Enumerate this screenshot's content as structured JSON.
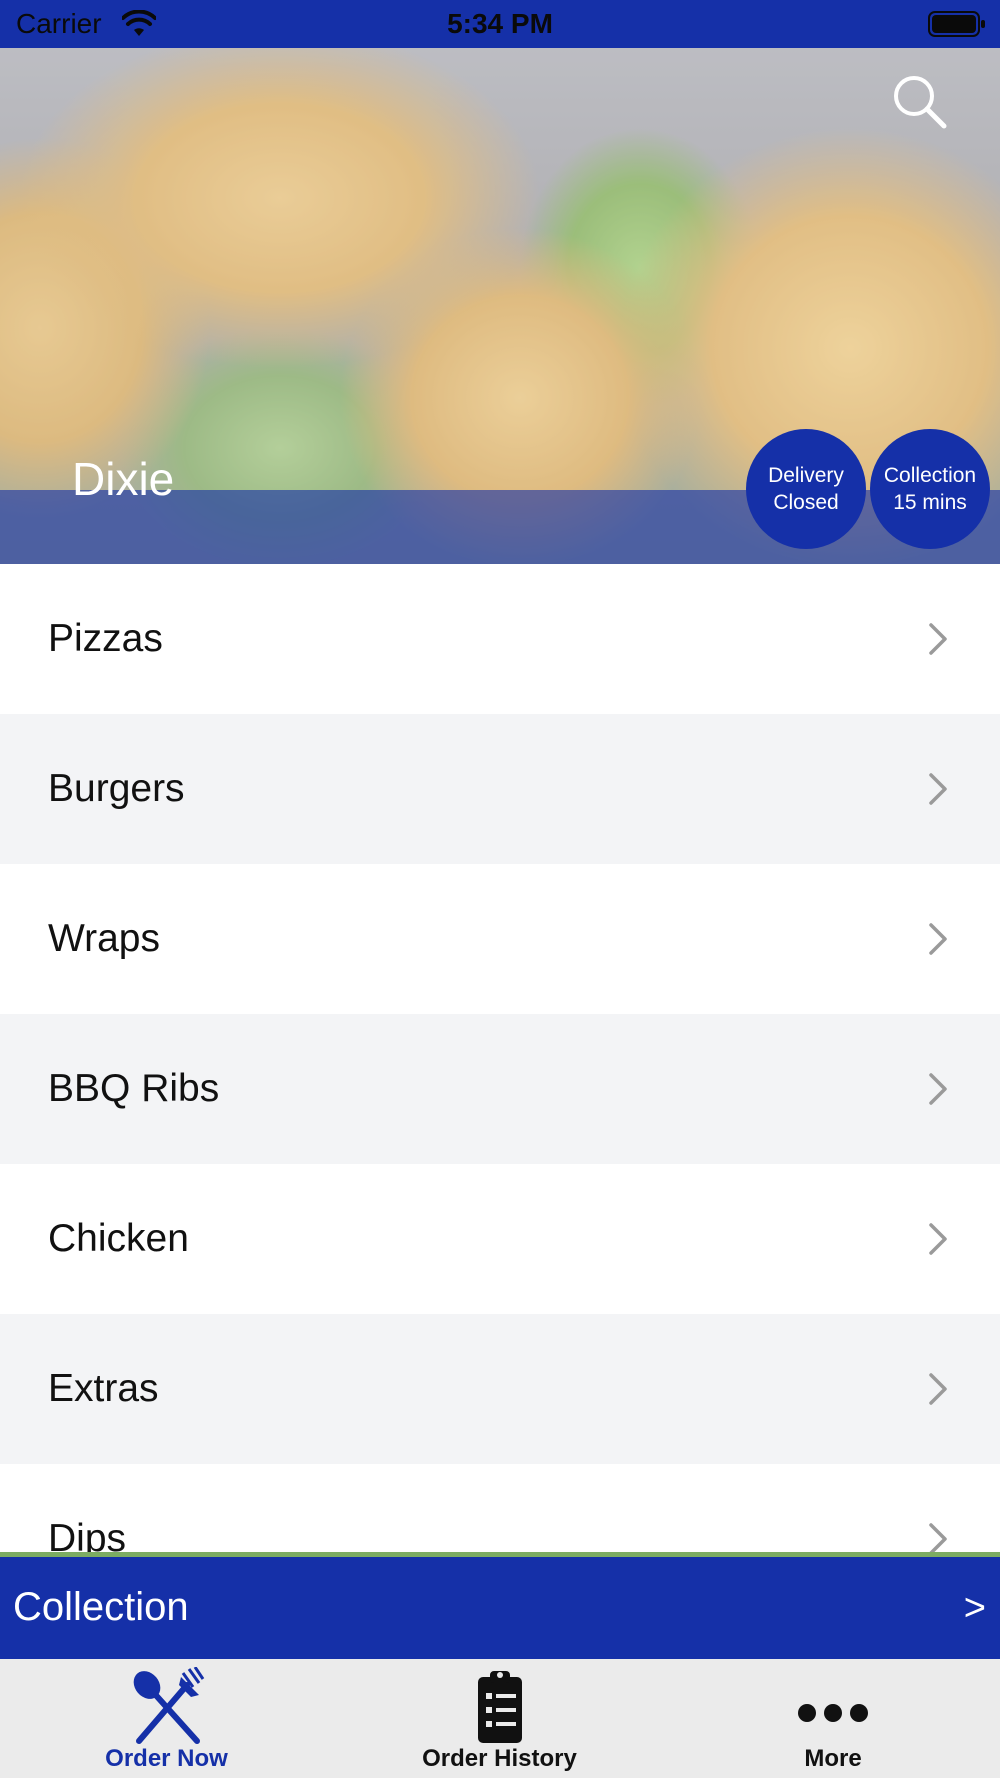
{
  "status_bar": {
    "carrier": "Carrier",
    "time": "5:34 PM"
  },
  "header": {
    "restaurant_name": "Dixie",
    "search_icon": "search-icon",
    "badges": {
      "delivery": {
        "line1": "Delivery",
        "line2": "Closed"
      },
      "collection": {
        "line1": "Collection",
        "line2": "15 mins"
      }
    }
  },
  "menu": {
    "items": [
      {
        "label": "Pizzas"
      },
      {
        "label": "Burgers"
      },
      {
        "label": "Wraps"
      },
      {
        "label": "BBQ Ribs"
      },
      {
        "label": "Chicken"
      },
      {
        "label": "Extras"
      },
      {
        "label": "Dips"
      }
    ]
  },
  "order_bar": {
    "mode_label": "Collection",
    "arrow": ">"
  },
  "tab_bar": {
    "tabs": [
      {
        "label": "Order Now",
        "icon": "fork-spoon-icon",
        "active": true
      },
      {
        "label": "Order History",
        "icon": "clipboard-list-icon",
        "active": false
      },
      {
        "label": "More",
        "icon": "more-dots-icon",
        "active": false
      }
    ]
  },
  "colors": {
    "brand_blue": "#1530a8",
    "accent_green": "#7cac62",
    "row_alt": "#f3f4f6"
  }
}
